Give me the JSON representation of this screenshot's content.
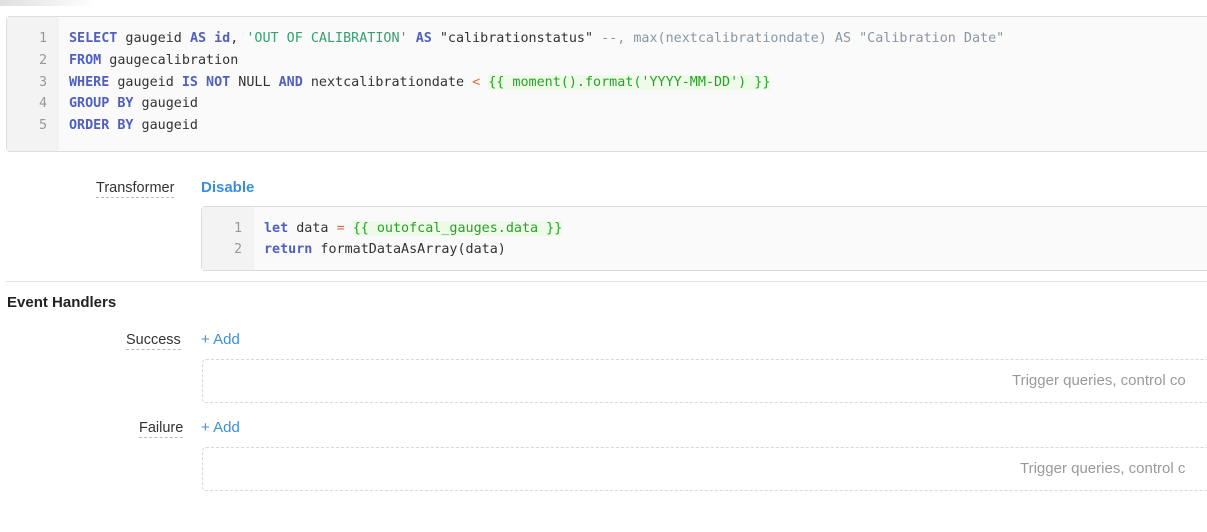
{
  "sql_editor": {
    "line_numbers": [
      "1",
      "2",
      "3",
      "4",
      "5"
    ],
    "lines": [
      {
        "tokens": [
          {
            "t": "SELECT",
            "c": "kw"
          },
          {
            "t": " gaugeid ",
            "c": "plain"
          },
          {
            "t": "AS",
            "c": "kw"
          },
          {
            "t": " ",
            "c": "plain"
          },
          {
            "t": "id",
            "c": "kw"
          },
          {
            "t": ", ",
            "c": "plain"
          },
          {
            "t": "'OUT OF CALIBRATION'",
            "c": "str"
          },
          {
            "t": " ",
            "c": "plain"
          },
          {
            "t": "AS",
            "c": "kw"
          },
          {
            "t": " ",
            "c": "plain"
          },
          {
            "t": "\"calibrationstatus\"",
            "c": "dq"
          },
          {
            "t": " --, max(nextcalibrationdate) AS \"Calibration Date\"",
            "c": "cm"
          }
        ]
      },
      {
        "tokens": [
          {
            "t": "FROM",
            "c": "kw"
          },
          {
            "t": " gaugecalibration",
            "c": "plain"
          }
        ]
      },
      {
        "tokens": [
          {
            "t": "WHERE",
            "c": "kw"
          },
          {
            "t": " gaugeid ",
            "c": "plain"
          },
          {
            "t": "IS NOT",
            "c": "kw"
          },
          {
            "t": " NULL ",
            "c": "plain"
          },
          {
            "t": "AND",
            "c": "kw"
          },
          {
            "t": " nextcalibrationdate ",
            "c": "plain"
          },
          {
            "t": "<",
            "c": "op"
          },
          {
            "t": " ",
            "c": "plain"
          },
          {
            "t": "{{ moment().format('YYYY-MM-DD') }}",
            "c": "tpl"
          }
        ]
      },
      {
        "tokens": [
          {
            "t": "GROUP BY",
            "c": "kw"
          },
          {
            "t": " gaugeid",
            "c": "plain"
          }
        ]
      },
      {
        "tokens": [
          {
            "t": "ORDER BY",
            "c": "kw"
          },
          {
            "t": " gaugeid",
            "c": "plain"
          }
        ]
      }
    ]
  },
  "transformer": {
    "label": "Transformer",
    "action": "Disable",
    "line_numbers": [
      "1",
      "2"
    ],
    "lines": [
      {
        "tokens": [
          {
            "t": "let",
            "c": "kw"
          },
          {
            "t": " data ",
            "c": "plain"
          },
          {
            "t": "=",
            "c": "op"
          },
          {
            "t": " ",
            "c": "plain"
          },
          {
            "t": "{{ outofcal_gauges.data }}",
            "c": "tpl"
          }
        ]
      },
      {
        "tokens": [
          {
            "t": "return",
            "c": "kw"
          },
          {
            "t": " formatDataAsArray(data)",
            "c": "plain"
          }
        ]
      }
    ]
  },
  "event_handlers": {
    "title": "Event Handlers",
    "success": {
      "label": "Success",
      "add": "+ Add",
      "placeholder": "Trigger queries, control co"
    },
    "failure": {
      "label": "Failure",
      "add": "+ Add",
      "placeholder": "Trigger queries, control c"
    }
  }
}
